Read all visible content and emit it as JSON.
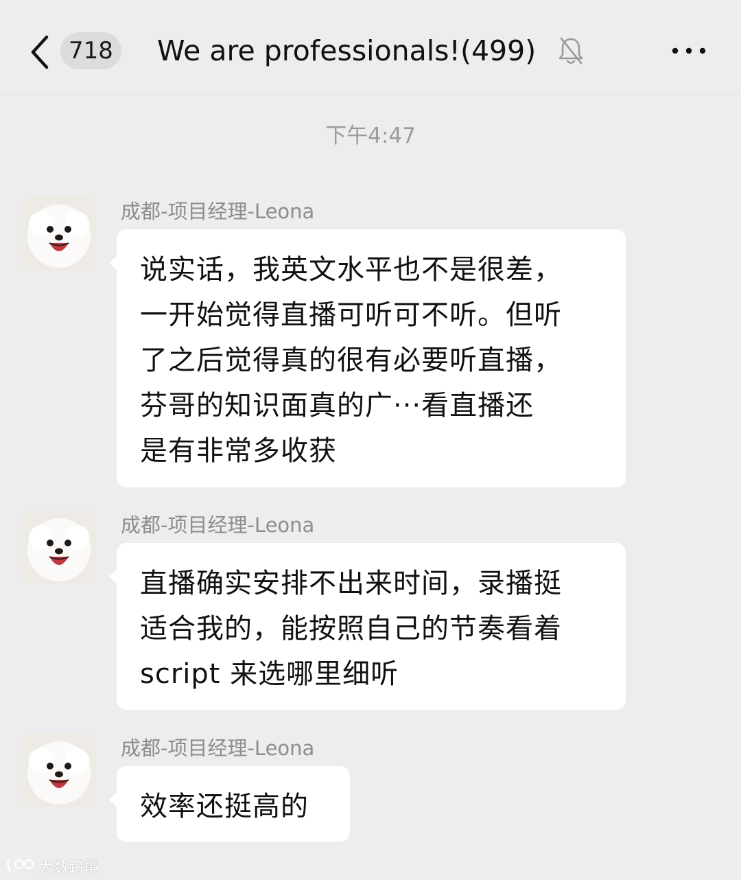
{
  "header": {
    "back_icon": "chevron-left-icon",
    "unread_count": "718",
    "title": "We are professionals!(499)",
    "mute_icon": "bell-off-icon",
    "more_icon": "more-horizontal-icon"
  },
  "timestamp": "下午4:47",
  "messages": [
    {
      "sender": "成都-项目经理-Leona",
      "text": "说实话，我英文水平也不是很差，\n一开始觉得直播可听可不听。但听\n了之后觉得真的很有必要听直播，\n芬哥的知识面真的广···看直播还\n是有非常多收获"
    },
    {
      "sender": "成都-项目经理-Leona",
      "text": "直播确实安排不出来时间，录播挺\n适合我的，能按照自己的节奏看着\nscript 来选哪里细听"
    },
    {
      "sender": "成都-项目经理-Leona",
      "text": "效率还挺高的"
    }
  ],
  "watermark": "大数跨境",
  "colors": {
    "background": "#ededed",
    "bubble": "#ffffff",
    "meta_text": "#9b9b9b"
  }
}
